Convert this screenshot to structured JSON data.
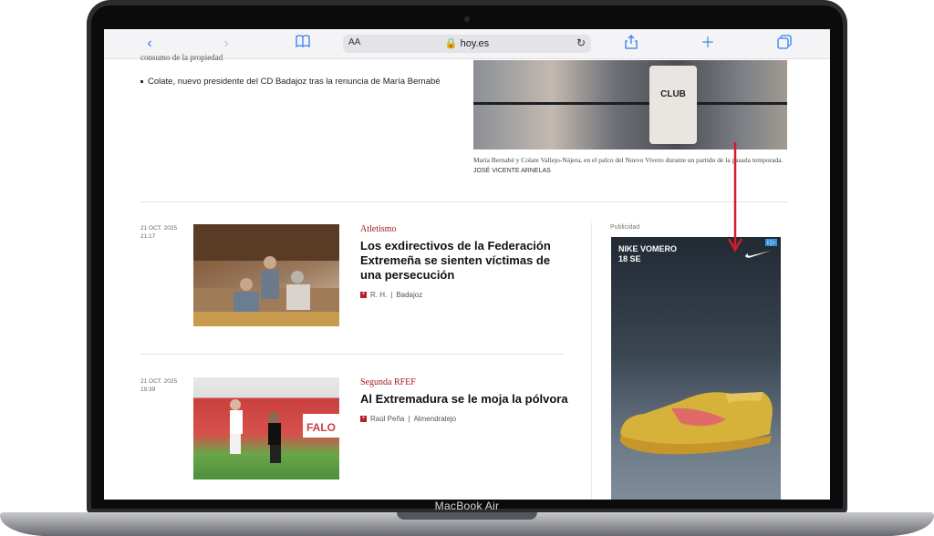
{
  "device": {
    "label": "MacBook Air"
  },
  "browser": {
    "text_size_label": "AA",
    "url": "hoy.es",
    "icons": [
      "back-icon",
      "forward-icon",
      "bookmarks-icon",
      "lock-icon",
      "reload-icon",
      "share-icon",
      "new-tab-icon",
      "tabs-icon"
    ]
  },
  "top": {
    "cut_text": "consumo de la propiedad",
    "bullet": "Colate, nuevo presidente del CD Badajoz tras la renuncia de María Bernabé",
    "photo_crest_text": "CLUB",
    "caption": "María Bernabé y Colate Vallejo-Nájera, en el palco del Nuevo Vivero durante un partido de la pasada temporada.",
    "credit": "JOSÉ VICENTE ARNELAS"
  },
  "articles": [
    {
      "date_line1": "21 OCT. 2025",
      "date_line2": "21:17",
      "section": "Atletismo",
      "headline": "Los exdirectivos de la Federación Extremeña se sienten víctimas de una persecución",
      "author": "R. H.",
      "place": "Badajoz"
    },
    {
      "date_line1": "21 OCT. 2025",
      "date_line2": "19:39",
      "section": "Segunda RFEF",
      "headline": "Al Extremadura se le moja la pólvora",
      "author": "Raúl Peña",
      "place": "Almendralejo",
      "banner_text": "FALO"
    }
  ],
  "ad": {
    "label": "Publicidad",
    "title": "NIKE VOMERO\n18 SE",
    "choices": "i ▷"
  },
  "colors": {
    "accent": "#2f7ef6",
    "section": "#a3191d",
    "arrow": "#d11e2b"
  }
}
